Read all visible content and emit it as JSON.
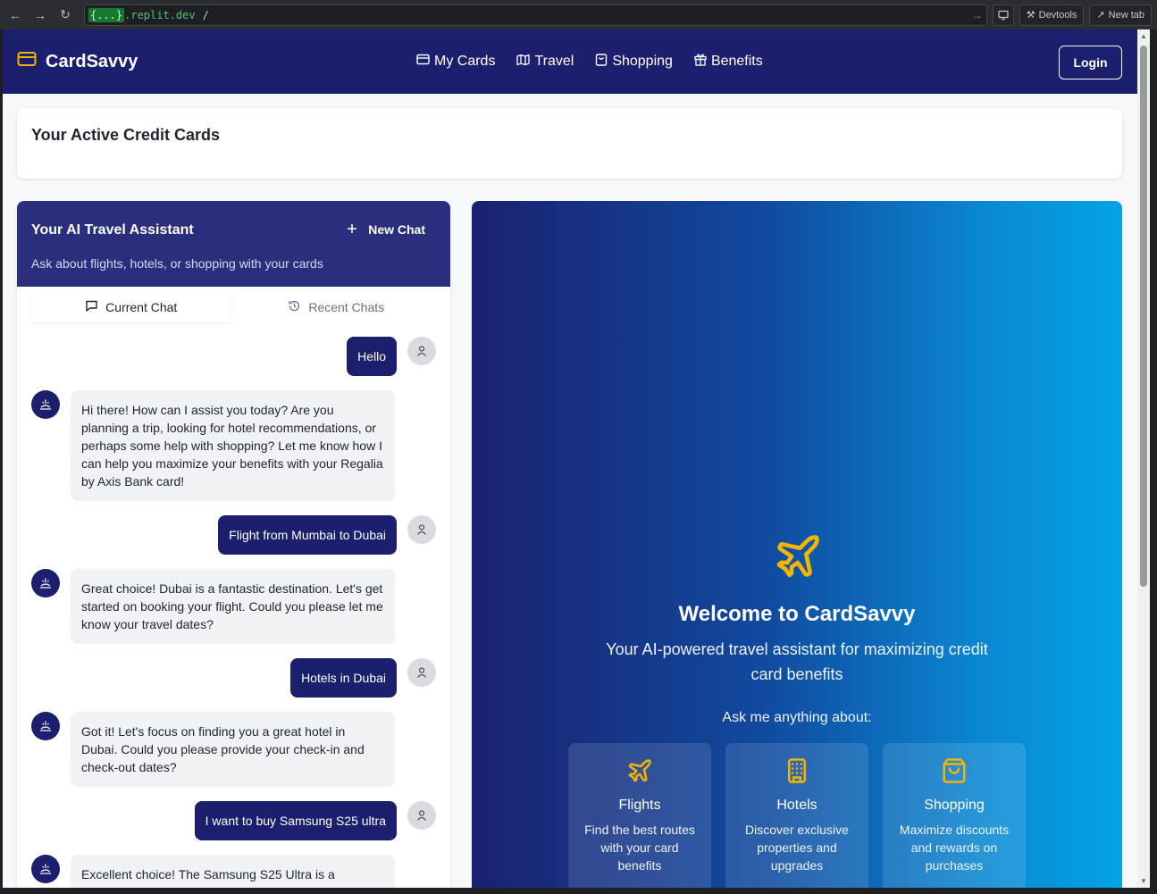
{
  "browser": {
    "url_host_highlight": "{...}",
    "url_host": ".replit.dev",
    "url_path": "/",
    "devtools_label": "Devtools",
    "newtab_label": "New tab"
  },
  "header": {
    "brand": "CardSavvy",
    "nav": [
      {
        "label": "My Cards",
        "icon": "credit-card-icon"
      },
      {
        "label": "Travel",
        "icon": "map-icon"
      },
      {
        "label": "Shopping",
        "icon": "shopping-bag-icon"
      },
      {
        "label": "Benefits",
        "icon": "gift-icon"
      }
    ],
    "login": "Login"
  },
  "active_cards": {
    "title": "Your Active Credit Cards"
  },
  "chat": {
    "title": "Your AI Travel Assistant",
    "new_chat": "New Chat",
    "subtitle": "Ask about flights, hotels, or shopping with your cards",
    "tabs": [
      {
        "label": "Current Chat",
        "active": true
      },
      {
        "label": "Recent Chats",
        "active": false
      }
    ],
    "messages": [
      {
        "role": "user",
        "text": "Hello"
      },
      {
        "role": "assistant",
        "text": "Hi there! How can I assist you today? Are you planning a trip, looking for hotel recommendations, or perhaps some help with shopping? Let me know how I can help you maximize your benefits with your Regalia by Axis Bank card!"
      },
      {
        "role": "user",
        "text": "Flight from Mumbai to Dubai"
      },
      {
        "role": "assistant",
        "text": "Great choice! Dubai is a fantastic destination. Let's get started on booking your flight. Could you please let me know your travel dates?"
      },
      {
        "role": "user",
        "text": "Hotels in Dubai"
      },
      {
        "role": "assistant",
        "text": "Got it! Let's focus on finding you a great hotel in Dubai. Could you please provide your check-in and check-out dates?"
      },
      {
        "role": "user",
        "text": "I want to buy Samsung S25 ultra"
      },
      {
        "role": "assistant",
        "text": "Excellent choice! The Samsung S25 Ultra is a"
      }
    ]
  },
  "welcome": {
    "title": "Welcome to CardSavvy",
    "tagline": "Your AI-powered travel assistant for maximizing credit card benefits",
    "ask": "Ask me anything about:",
    "features": [
      {
        "title": "Flights",
        "desc": "Find the best routes with your card benefits",
        "icon": "plane-icon"
      },
      {
        "title": "Hotels",
        "desc": "Discover exclusive properties and upgrades",
        "icon": "building-icon"
      },
      {
        "title": "Shopping",
        "desc": "Maximize discounts and rewards on purchases",
        "icon": "shopping-bag-icon"
      }
    ]
  },
  "colors": {
    "primary": "#1b1f6e",
    "accent": "#f5b400",
    "chat_header": "#2a2f7d"
  }
}
